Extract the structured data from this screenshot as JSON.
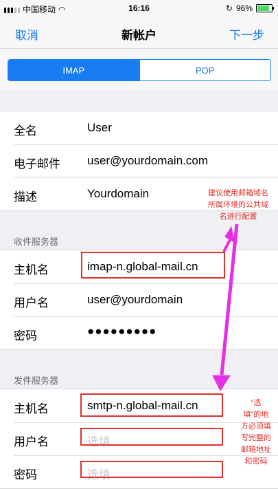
{
  "status_bar": {
    "carrier": "中国移动",
    "time": "16:16",
    "battery": "96%",
    "battery_level": 0.96
  },
  "nav": {
    "cancel": "取消",
    "title": "新帐户",
    "next": "下一步"
  },
  "segment": {
    "options": [
      "IMAP",
      "POP"
    ],
    "selected": "IMAP"
  },
  "account": [
    {
      "label": "全名",
      "value": "User"
    },
    {
      "label": "电子邮件",
      "value": "user@yourdomain.com"
    },
    {
      "label": "描述",
      "value": "Yourdomain"
    }
  ],
  "incoming": {
    "header": "收件服务器",
    "host": {
      "label": "主机名",
      "value": "imap-n.global-mail.cn"
    },
    "user": {
      "label": "用户名",
      "value": "user@yourdomain"
    },
    "password": {
      "label": "密码",
      "value": "●●●●●●●●●"
    }
  },
  "outgoing": {
    "header": "发件服务器",
    "host": {
      "label": "主机名",
      "value": "smtp-n.global-mail.cn"
    },
    "user": {
      "label": "用户名",
      "placeholder": "选填"
    },
    "password": {
      "label": "密码",
      "placeholder": "选填"
    }
  },
  "annotations": {
    "note1": [
      "建议使用邮箱域名",
      "所属环境的公共域",
      "名进行配置"
    ],
    "note2": [
      "“选",
      "填”的地",
      "方必须填",
      "写完整的",
      "邮箱地址",
      "和密码"
    ],
    "color": "#e2302c",
    "arrow_color": "#e62ee6"
  }
}
